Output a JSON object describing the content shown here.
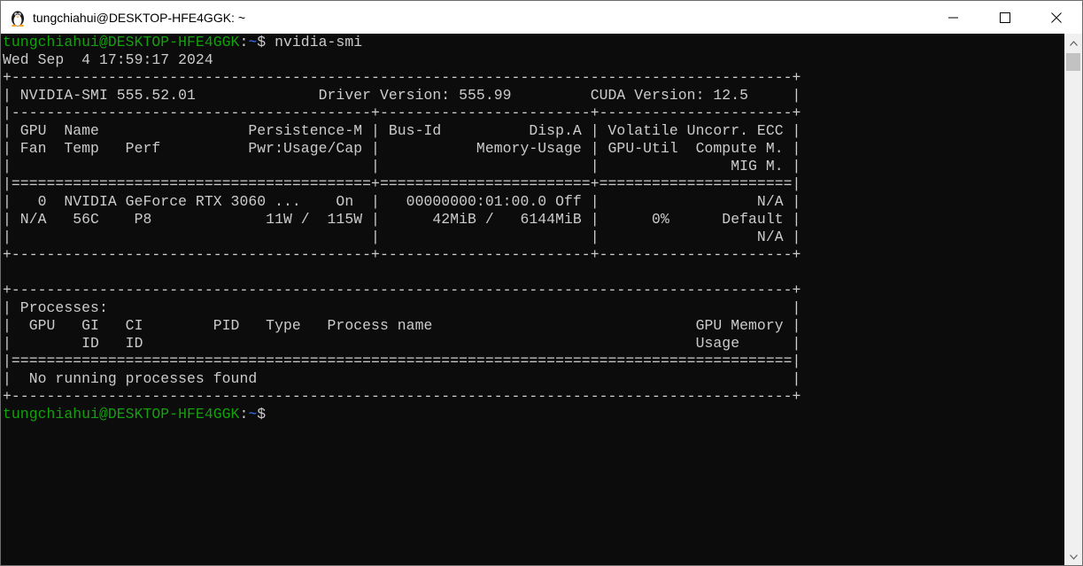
{
  "window": {
    "title": "tungchiahui@DESKTOP-HFE4GGK: ~"
  },
  "colors": {
    "prompt_user": "#13a10e",
    "prompt_path": "#3b78ff",
    "text": "#cccccc",
    "background": "#0c0c0c"
  },
  "prompt": {
    "user_host": "tungchiahui@DESKTOP-HFE4GGK",
    "colon": ":",
    "path": "~",
    "symbol": "$ "
  },
  "command": "nvidia-smi",
  "output": [
    "Wed Sep  4 17:59:17 2024",
    "+-----------------------------------------------------------------------------------------+",
    "| NVIDIA-SMI 555.52.01              Driver Version: 555.99         CUDA Version: 12.5     |",
    "|-----------------------------------------+------------------------+----------------------+",
    "| GPU  Name                 Persistence-M | Bus-Id          Disp.A | Volatile Uncorr. ECC |",
    "| Fan  Temp   Perf          Pwr:Usage/Cap |           Memory-Usage | GPU-Util  Compute M. |",
    "|                                         |                        |               MIG M. |",
    "|=========================================+========================+======================|",
    "|   0  NVIDIA GeForce RTX 3060 ...    On  |   00000000:01:00.0 Off |                  N/A |",
    "| N/A   56C    P8             11W /  115W |      42MiB /   6144MiB |      0%      Default |",
    "|                                         |                        |                  N/A |",
    "+-----------------------------------------+------------------------+----------------------+",
    "",
    "+-----------------------------------------------------------------------------------------+",
    "| Processes:                                                                              |",
    "|  GPU   GI   CI        PID   Type   Process name                              GPU Memory |",
    "|        ID   ID                                                               Usage      |",
    "|=========================================================================================|",
    "|  No running processes found                                                             |",
    "+-----------------------------------------------------------------------------------------+"
  ],
  "icons": {
    "app": "penguin-icon",
    "minimize": "minimize-icon",
    "maximize": "maximize-icon",
    "close": "close-icon"
  }
}
